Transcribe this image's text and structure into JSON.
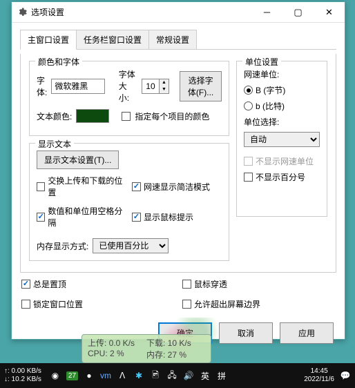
{
  "window": {
    "title": "选项设置"
  },
  "tabs": {
    "main": "主窗口设置",
    "taskbar": "任务栏窗口设置",
    "general": "常规设置"
  },
  "colorFont": {
    "groupTitle": "颜色和字体",
    "fontLabel": "字体:",
    "fontValue": "微软雅黑",
    "fontSizeLabel": "字体大小:",
    "fontSizeValue": "10",
    "selectFontBtn": "选择字体(F)...",
    "textColorLabel": "文本颜色:",
    "colorValue": "#0d4a0d",
    "perItemColor": "指定每个项目的颜色"
  },
  "displayText": {
    "groupTitle": "显示文本",
    "settingsBtn": "显示文本设置(T)...",
    "swapUpDown": "交换上传和下载的位置",
    "conciseSpeed": "网速显示简洁模式",
    "spaceSep": "数值和单位用空格分隔",
    "mouseTooltip": "显示鼠标提示",
    "memDisplayLabel": "内存显示方式:",
    "memDisplayValue": "已使用百分比"
  },
  "unit": {
    "groupTitle": "单位设置",
    "speedUnitLabel": "网速单位:",
    "byteOpt": "B (字节)",
    "bitOpt": "b (比特)",
    "unitSelectLabel": "单位选择:",
    "unitSelectValue": "自动",
    "hideSpeedUnit": "不显示网速单位",
    "hidePercent": "不显示百分号"
  },
  "bottom": {
    "alwaysTop": "总是置顶",
    "mouseThrough": "鼠标穿透",
    "lockPos": "锁定窗口位置",
    "allowOffscreen": "允许超出屏幕边界"
  },
  "buttons": {
    "ok": "确定",
    "cancel": "取消",
    "apply": "应用"
  },
  "overlay": {
    "upload": "上传: 0.0 K/s",
    "download": "下载: 10 K/s",
    "cpu": "CPU: 2 %",
    "mem": "内存: 27 %"
  },
  "taskbar": {
    "up": "↑: 0.00 KB/s",
    "down": "↓: 10.2 KB/s",
    "badge": "27",
    "ime1": "英",
    "ime2": "拼",
    "time": "14:45",
    "date": "2022/11/6"
  }
}
